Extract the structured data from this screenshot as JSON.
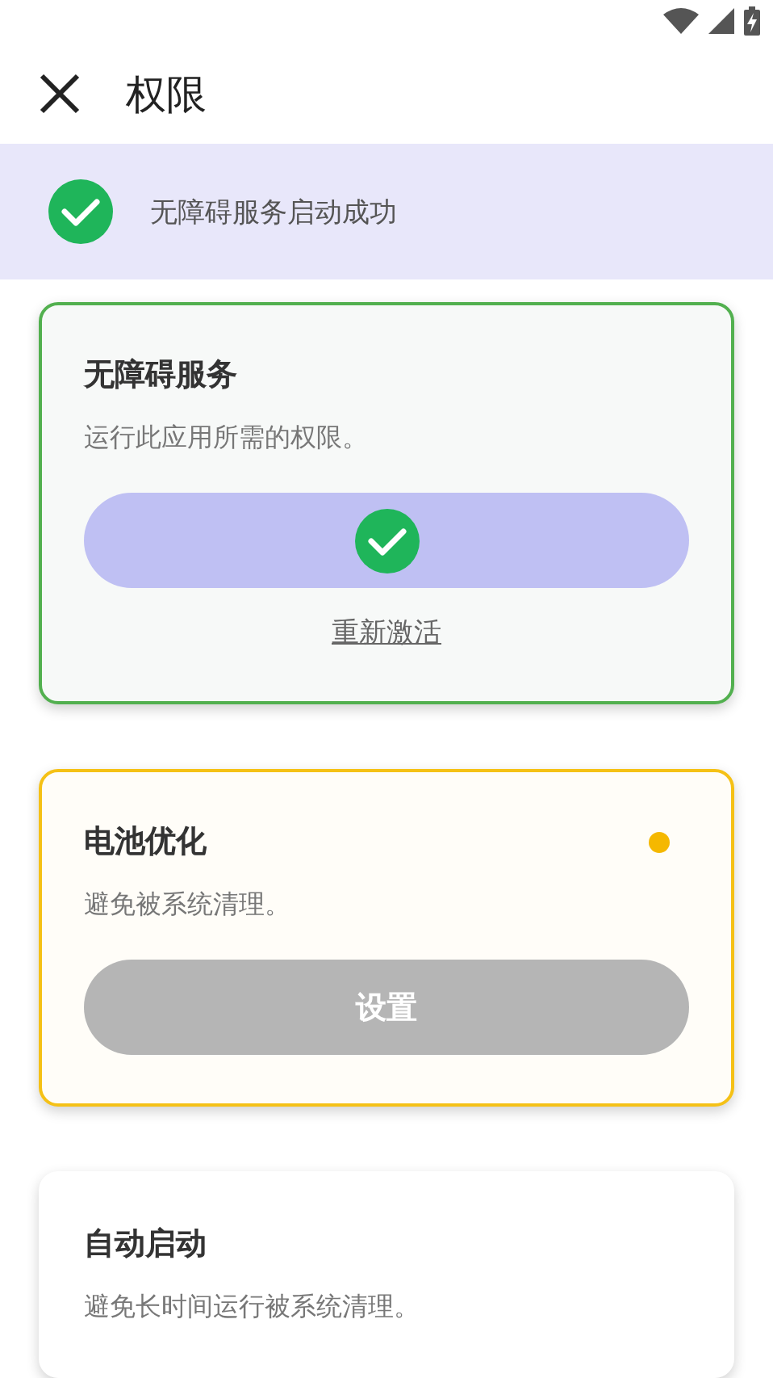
{
  "header": {
    "title": "权限"
  },
  "banner": {
    "text": "无障碍服务启动成功"
  },
  "cards": [
    {
      "title": "无障碍服务",
      "description": "运行此应用所需的权限。",
      "kind": "granted",
      "action": {
        "kind": "check"
      },
      "link": "重新激活"
    },
    {
      "title": "电池优化",
      "description": "避免被系统清理。",
      "kind": "pending",
      "color": "#f5b800",
      "action": {
        "kind": "label",
        "label": "设置"
      }
    },
    {
      "title": "自动启动",
      "description": "避免长时间运行被系统清理。",
      "kind": "neutral"
    }
  ]
}
